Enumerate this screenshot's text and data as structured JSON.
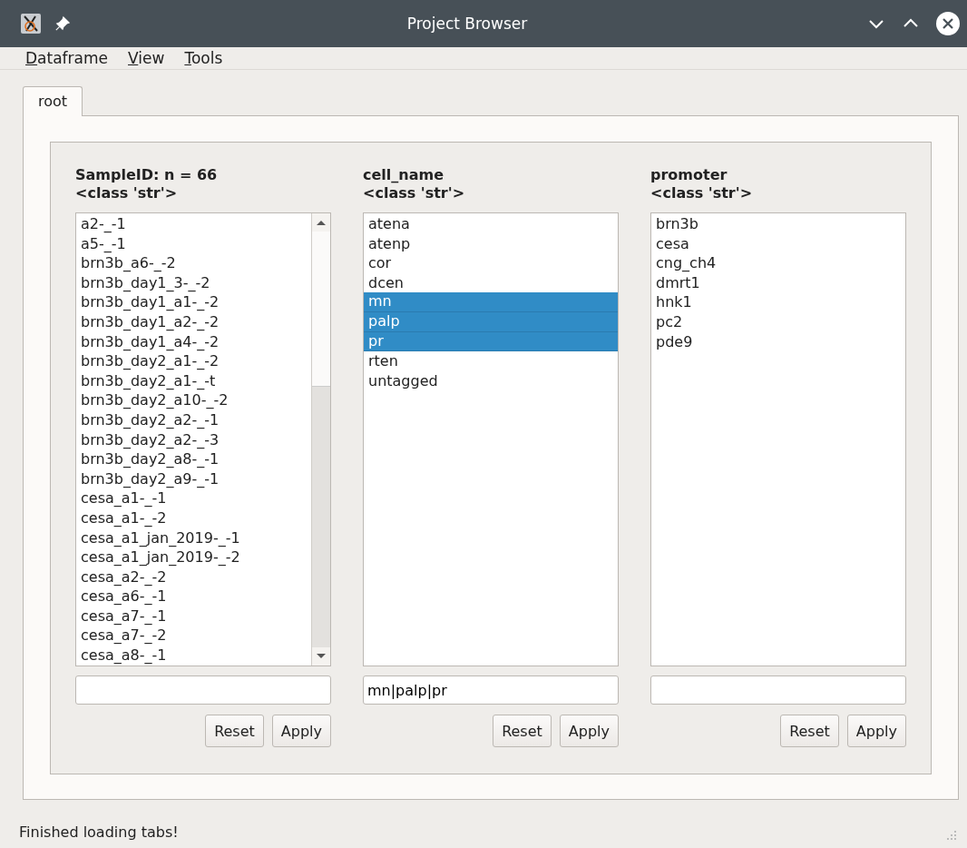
{
  "window": {
    "title": "Project Browser"
  },
  "menu": [
    "Dataframe",
    "View",
    "Tools"
  ],
  "tabs": [
    {
      "label": "root",
      "selected": true
    }
  ],
  "columns": [
    {
      "title": "SampleID: n = 66",
      "type": "<class 'str'>",
      "scrollbar": true,
      "items": [
        {
          "label": "a2-_-1",
          "selected": false
        },
        {
          "label": "a5-_-1",
          "selected": false
        },
        {
          "label": "brn3b_a6-_-2",
          "selected": false
        },
        {
          "label": "brn3b_day1_3-_-2",
          "selected": false
        },
        {
          "label": "brn3b_day1_a1-_-2",
          "selected": false
        },
        {
          "label": "brn3b_day1_a2-_-2",
          "selected": false
        },
        {
          "label": "brn3b_day1_a4-_-2",
          "selected": false
        },
        {
          "label": "brn3b_day2_a1-_-2",
          "selected": false
        },
        {
          "label": "brn3b_day2_a1-_-t",
          "selected": false
        },
        {
          "label": "brn3b_day2_a10-_-2",
          "selected": false
        },
        {
          "label": "brn3b_day2_a2-_-1",
          "selected": false
        },
        {
          "label": "brn3b_day2_a2-_-3",
          "selected": false
        },
        {
          "label": "brn3b_day2_a8-_-1",
          "selected": false
        },
        {
          "label": "brn3b_day2_a9-_-1",
          "selected": false
        },
        {
          "label": "cesa_a1-_-1",
          "selected": false
        },
        {
          "label": "cesa_a1-_-2",
          "selected": false
        },
        {
          "label": "cesa_a1_jan_2019-_-1",
          "selected": false
        },
        {
          "label": "cesa_a1_jan_2019-_-2",
          "selected": false
        },
        {
          "label": "cesa_a2-_-2",
          "selected": false
        },
        {
          "label": "cesa_a6-_-1",
          "selected": false
        },
        {
          "label": "cesa_a7-_-1",
          "selected": false
        },
        {
          "label": "cesa_a7-_-2",
          "selected": false
        },
        {
          "label": "cesa_a8-_-1",
          "selected": false
        }
      ],
      "buttons": [
        "Reset",
        "Apply"
      ]
    },
    {
      "title": "cell_name",
      "type": "<class 'str'>",
      "scrollbar": false,
      "items": [
        {
          "label": "atena",
          "selected": false
        },
        {
          "label": "atenp",
          "selected": false
        },
        {
          "label": "cor",
          "selected": false
        },
        {
          "label": "dcen",
          "selected": false
        },
        {
          "label": "mn",
          "selected": true
        },
        {
          "label": "palp",
          "selected": true
        },
        {
          "label": "pr",
          "selected": true
        },
        {
          "label": "rten",
          "selected": false
        },
        {
          "label": "untagged",
          "selected": false
        }
      ],
      "filter": "mn|palp|pr",
      "buttons": [
        "Reset",
        "Apply"
      ]
    },
    {
      "title": "promoter",
      "type": "<class 'str'>",
      "scrollbar": false,
      "items": [
        {
          "label": "brn3b",
          "selected": false
        },
        {
          "label": "cesa",
          "selected": false
        },
        {
          "label": "cng_ch4",
          "selected": false
        },
        {
          "label": "dmrt1",
          "selected": false
        },
        {
          "label": "hnk1",
          "selected": false
        },
        {
          "label": "pc2",
          "selected": false
        },
        {
          "label": "pde9",
          "selected": false
        }
      ],
      "buttons": [
        "Reset",
        "Apply"
      ]
    }
  ],
  "status_bar": "Finished loading tabs!"
}
